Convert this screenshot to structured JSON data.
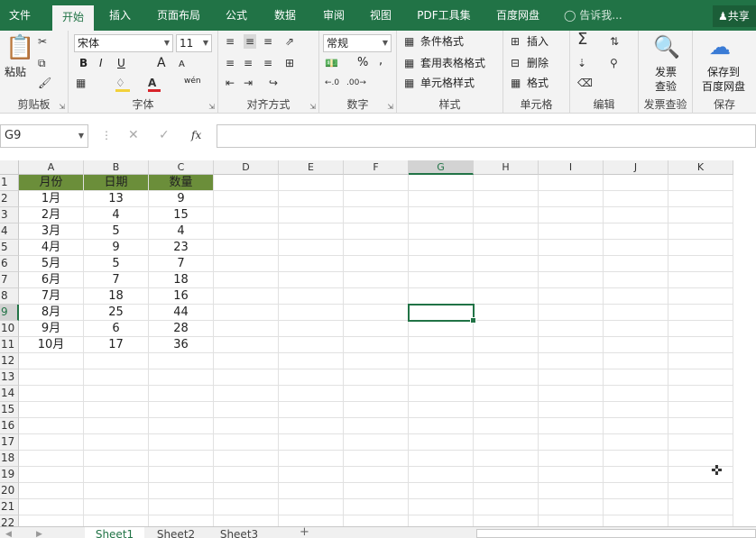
{
  "menu": {
    "tabs": [
      {
        "label": "文件"
      },
      {
        "label": "开始"
      },
      {
        "label": "插入"
      },
      {
        "label": "页面布局"
      },
      {
        "label": "公式"
      },
      {
        "label": "数据"
      },
      {
        "label": "审阅"
      },
      {
        "label": "视图"
      },
      {
        "label": "PDF工具集"
      },
      {
        "label": "百度网盘"
      }
    ],
    "tell_me": "告诉我...",
    "share": "共享"
  },
  "ribbon": {
    "clipboard": {
      "label": "剪贴板",
      "paste": "粘贴"
    },
    "font": {
      "label": "字体",
      "name": "宋体",
      "size": "11",
      "bold": "B",
      "italic": "I",
      "underline": "U",
      "grow": "A",
      "shrink": "A",
      "wen": "wén"
    },
    "alignment": {
      "label": "对齐方式"
    },
    "number": {
      "label": "数字",
      "format": "常规",
      "percent": "%",
      "comma": ","
    },
    "styles": {
      "label": "样式",
      "conditional": "条件格式",
      "table": "套用表格格式",
      "cell": "单元格样式"
    },
    "cells": {
      "label": "单元格",
      "insert": "插入",
      "delete": "删除",
      "format": "格式"
    },
    "editing": {
      "label": "编辑"
    },
    "invoice": {
      "label": "发票查验",
      "button": "发票\n查验"
    },
    "save": {
      "label": "保存",
      "button_line1": "保存到",
      "button_line2": "百度网盘"
    }
  },
  "formula_bar": {
    "name_box": "G9",
    "fx": "fx",
    "content": ""
  },
  "grid": {
    "columns": [
      "A",
      "B",
      "C",
      "D",
      "E",
      "F",
      "G",
      "H",
      "I",
      "J",
      "K"
    ],
    "selected_column": "G",
    "selected_row": 9,
    "rows": [
      1,
      2,
      3,
      4,
      5,
      6,
      7,
      8,
      9,
      10,
      11,
      12,
      13,
      14,
      15,
      16,
      17,
      18,
      19,
      20,
      21,
      22
    ],
    "header": [
      "月份",
      "日期",
      "数量"
    ],
    "data": [
      [
        "1月",
        "13",
        "9"
      ],
      [
        "2月",
        "4",
        "15"
      ],
      [
        "3月",
        "5",
        "4"
      ],
      [
        "4月",
        "9",
        "23"
      ],
      [
        "5月",
        "5",
        "7"
      ],
      [
        "6月",
        "7",
        "18"
      ],
      [
        "7月",
        "18",
        "16"
      ],
      [
        "8月",
        "25",
        "44"
      ],
      [
        "9月",
        "6",
        "28"
      ],
      [
        "10月",
        "17",
        "36"
      ]
    ],
    "header_color": "#6b8e3a",
    "accent": "#217346"
  },
  "sheets": [
    {
      "label": "Sheet1"
    },
    {
      "label": "Sheet2"
    },
    {
      "label": "Sheet3"
    }
  ],
  "add_sheet": "+"
}
